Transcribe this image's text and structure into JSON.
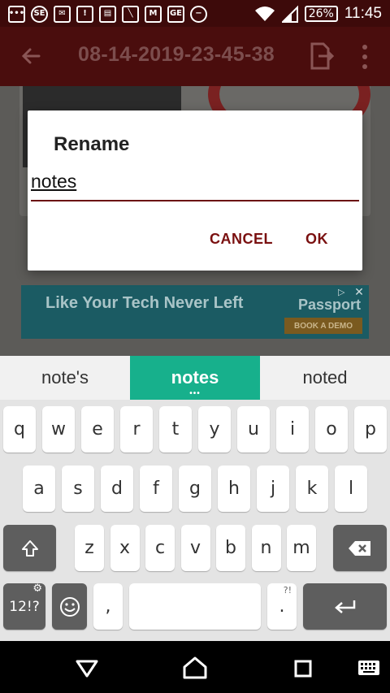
{
  "status_bar": {
    "notification_icons": [
      {
        "name": "messages-icon",
        "glyph": "•••"
      },
      {
        "name": "app-notification-icon",
        "glyph": "SE"
      },
      {
        "name": "chat-notification-icon",
        "glyph": "✉"
      },
      {
        "name": "alert-icon",
        "glyph": "!"
      },
      {
        "name": "news-icon",
        "glyph": "▤"
      },
      {
        "name": "signal-off-icon",
        "glyph": "╲"
      },
      {
        "name": "gmail-icon",
        "glyph": "M"
      },
      {
        "name": "ge-app-icon",
        "glyph": "GE"
      },
      {
        "name": "do-not-disturb-icon",
        "glyph": "−"
      }
    ],
    "battery": "26%",
    "time": "11:45"
  },
  "app_bar": {
    "title": "08-14-2019-23-45-38"
  },
  "ad_banner": {
    "headline": "Like Your Tech Never Left",
    "brand": "Passport",
    "cta": "BOOK A DEMO"
  },
  "dialog": {
    "title": "Rename",
    "input_value": "notes",
    "cancel_label": "CANCEL",
    "ok_label": "OK"
  },
  "suggestions": {
    "items": [
      "note's",
      "notes",
      "noted"
    ],
    "active_index": 1,
    "active_dots": "•••"
  },
  "keyboard": {
    "row1": [
      "q",
      "w",
      "e",
      "r",
      "t",
      "y",
      "u",
      "i",
      "o",
      "p"
    ],
    "row2": [
      "a",
      "s",
      "d",
      "f",
      "g",
      "h",
      "j",
      "k",
      "l"
    ],
    "row3": [
      "z",
      "x",
      "c",
      "v",
      "b",
      "n",
      "m"
    ],
    "symbols_label": "12!?",
    "comma_label": ",",
    "period_label": ".",
    "period_sup": "?!"
  },
  "colors": {
    "status_bar": "#3d0a0a",
    "app_bar": "#4a0d0d",
    "accent": "#7a1010",
    "suggestion_active": "#17b08c"
  }
}
